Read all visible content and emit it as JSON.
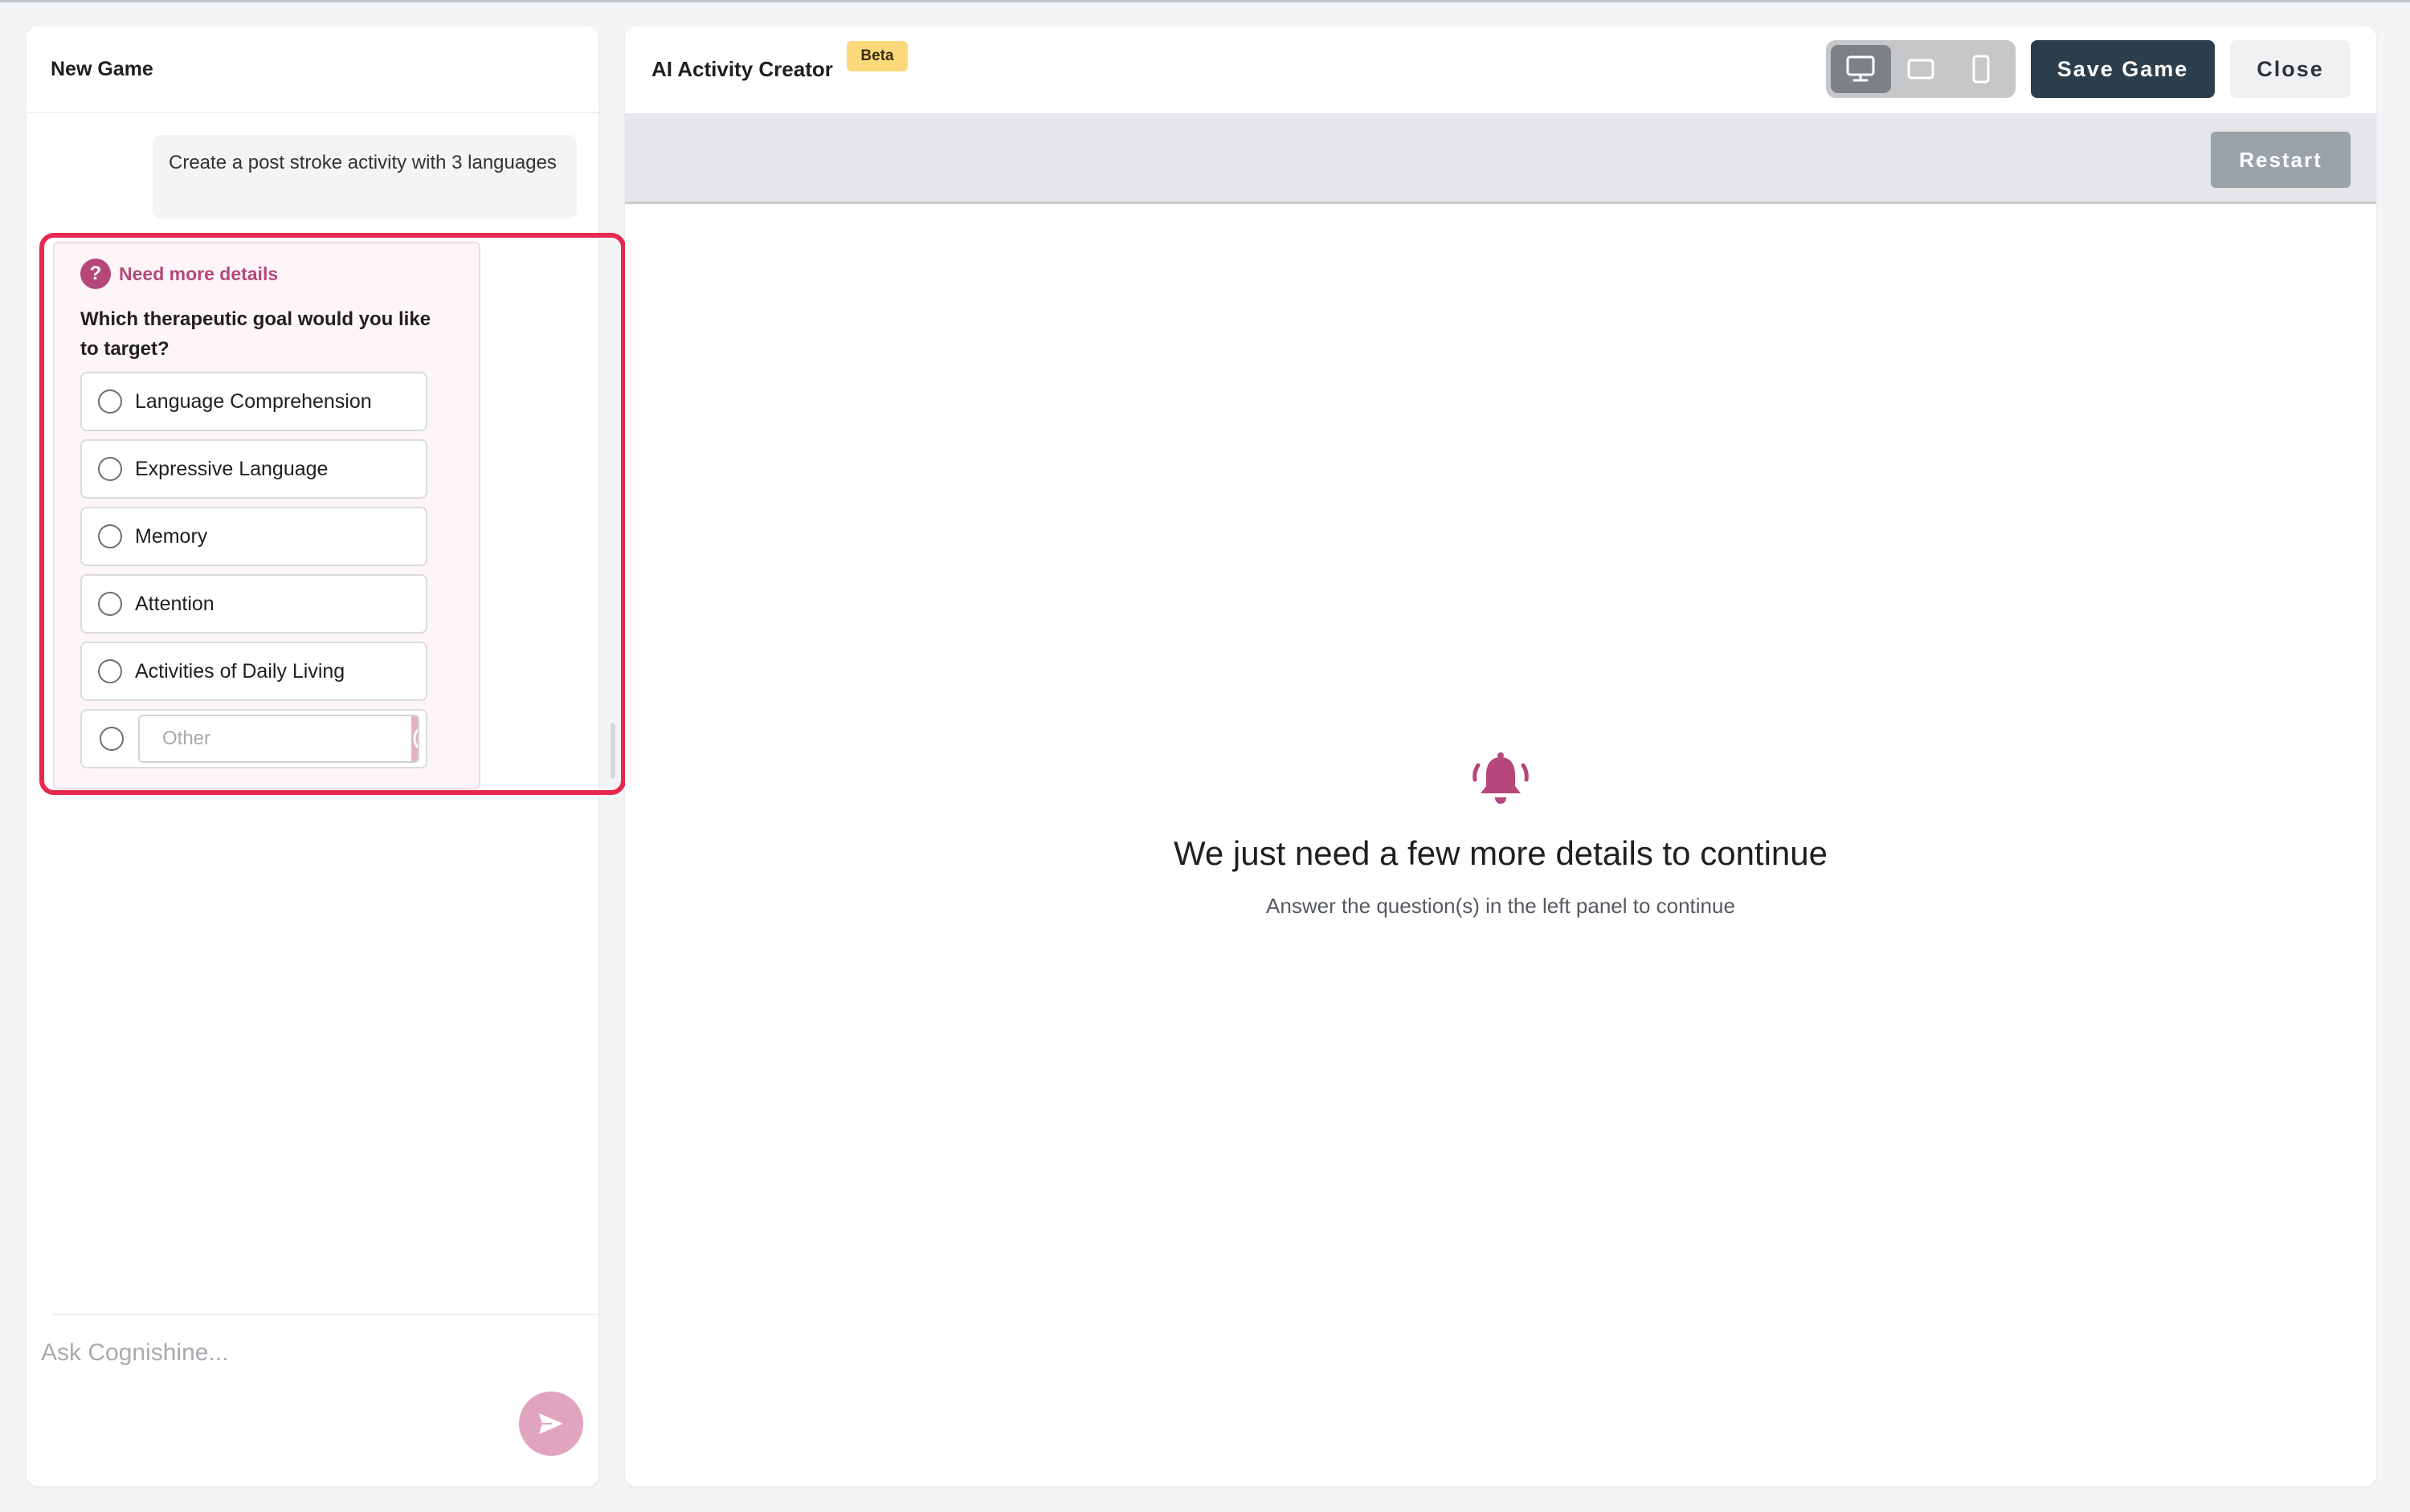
{
  "left_panel": {
    "title": "New Game",
    "user_message": "Create a post stroke activity with 3 languages",
    "question_card": {
      "header": "Need more details",
      "question": "Which therapeutic goal would you like to target?",
      "options": [
        "Language Comprehension",
        "Expressive Language",
        "Memory",
        "Attention",
        "Activities of Daily Living"
      ],
      "other_placeholder": "Other"
    },
    "chat_input_placeholder": "Ask Cognishine..."
  },
  "right_panel": {
    "title": "AI Activity Creator",
    "badge": "Beta",
    "device_modes": [
      {
        "icon": "desktop-icon",
        "active": true
      },
      {
        "icon": "tablet-icon",
        "active": false
      },
      {
        "icon": "phone-icon",
        "active": false
      }
    ],
    "save_label": "Save Game",
    "close_label": "Close",
    "restart_label": "Restart",
    "empty_state": {
      "icon": "bell-icon",
      "title": "We just need a few more details to continue",
      "subtitle": "Answer the question(s) in the left panel to continue"
    }
  },
  "colors": {
    "accent": "#b5477a",
    "highlight": "#e8294f",
    "primary_button": "#2c3e4c",
    "badge": "#fbd97a"
  }
}
